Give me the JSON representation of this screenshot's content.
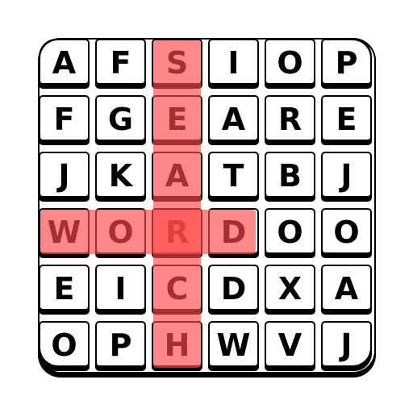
{
  "grid": [
    [
      "A",
      "F",
      "S",
      "I",
      "O",
      "P"
    ],
    [
      "F",
      "G",
      "E",
      "A",
      "R",
      "E"
    ],
    [
      "J",
      "K",
      "A",
      "T",
      "B",
      "J"
    ],
    [
      "W",
      "O",
      "R",
      "D",
      "O",
      "O"
    ],
    [
      "E",
      "I",
      "C",
      "D",
      "X",
      "A"
    ],
    [
      "O",
      "P",
      "H",
      "W",
      "V",
      "J"
    ]
  ],
  "found_words": [
    {
      "word": "SEARCH",
      "direction": "vertical",
      "col": 2,
      "start_row": 0,
      "length": 6
    },
    {
      "word": "WORD",
      "direction": "horizontal",
      "row": 3,
      "start_col": 0,
      "length": 4
    }
  ],
  "colors": {
    "highlight": "#ff4a4a",
    "tile_border": "#000000",
    "tile_face": "#ffffff",
    "letter": "#000000"
  }
}
